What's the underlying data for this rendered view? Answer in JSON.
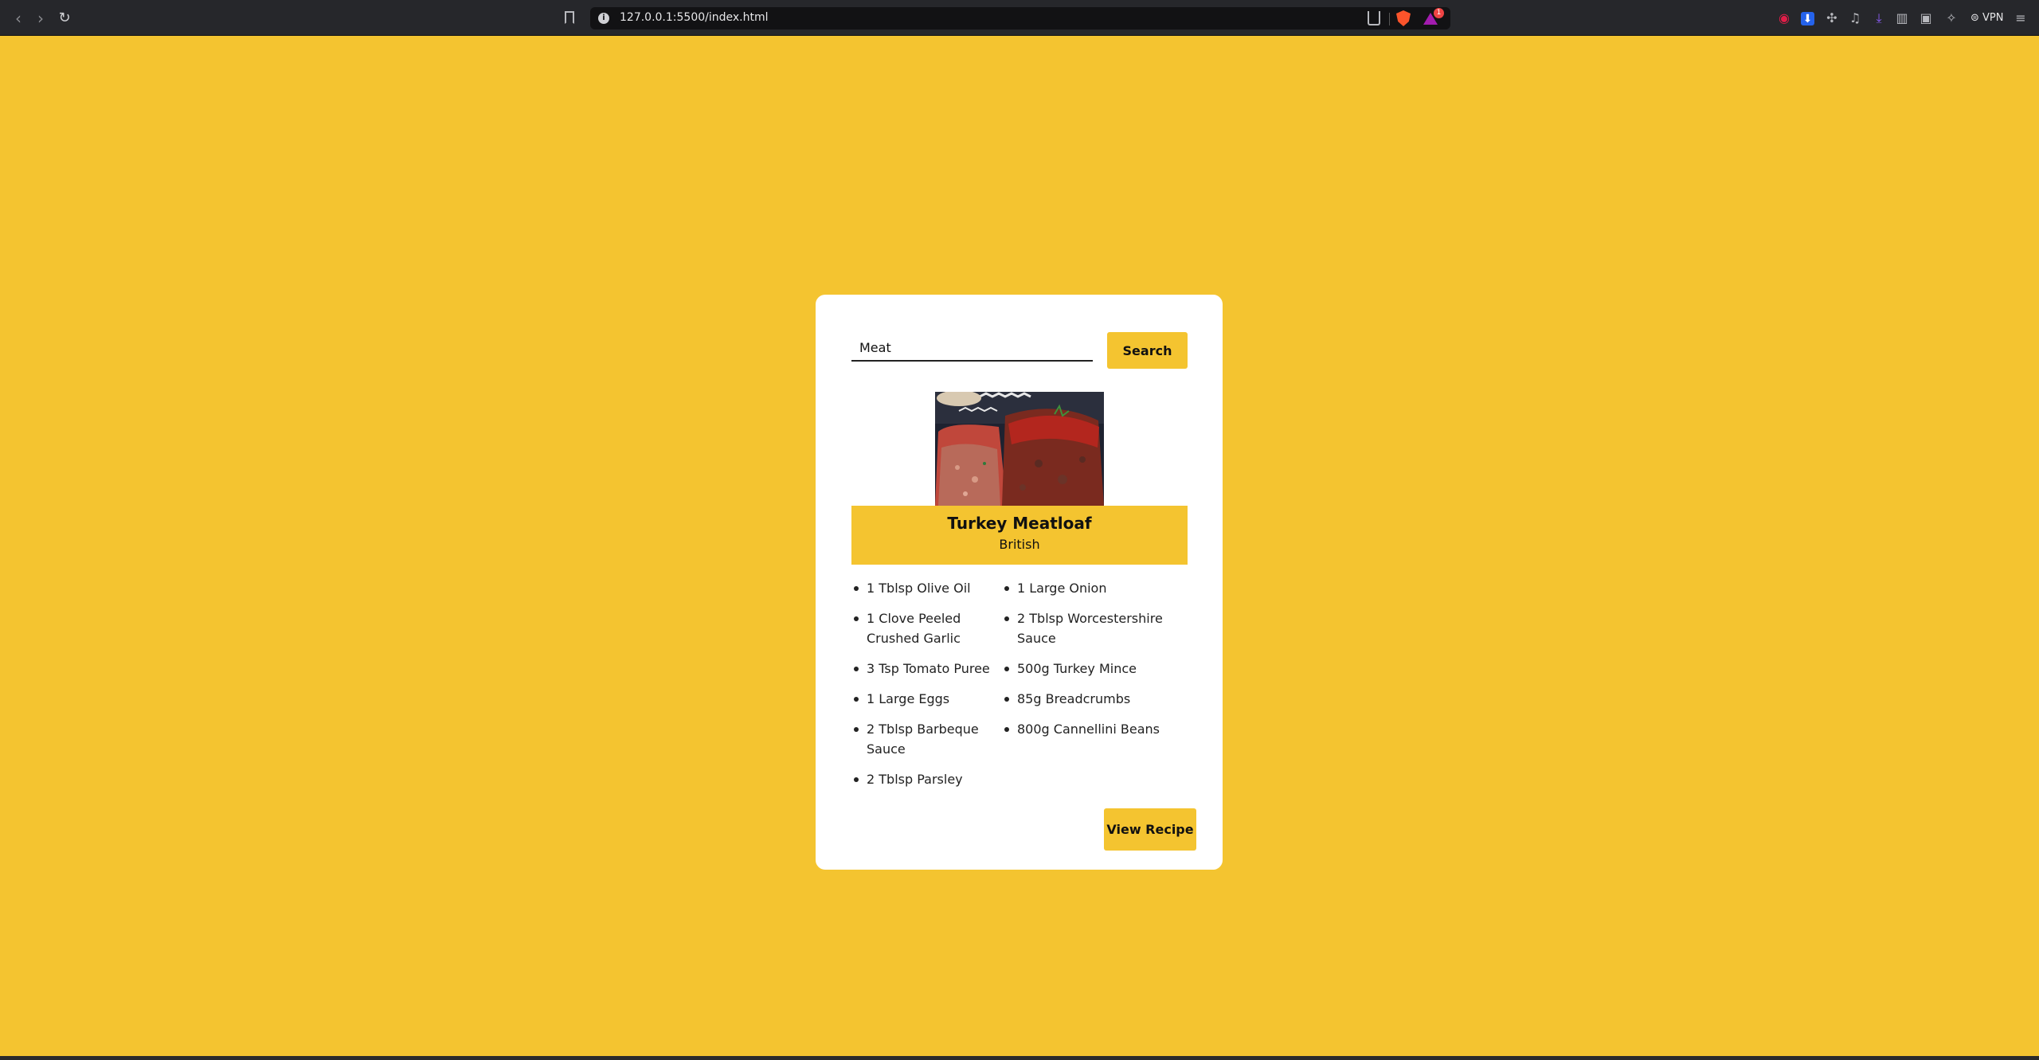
{
  "browser": {
    "url": "127.0.0.1:5500/index.html",
    "rewards_badge": "1",
    "vpn_label": "VPN"
  },
  "search": {
    "value": "Meat",
    "button_label": "Search"
  },
  "meal": {
    "title": "Turkey Meatloaf",
    "area": "British",
    "ingredients": [
      "1 Tblsp Olive Oil",
      "1 Clove Peeled Crushed Garlic",
      "3 Tsp Tomato Puree",
      "1 Large Eggs",
      "2 Tblsp Barbeque Sauce",
      "2 Tblsp Parsley",
      "1 Large Onion",
      "2 Tblsp Worcestershire Sauce",
      "500g Turkey Mince",
      "85g Breadcrumbs",
      "800g Cannellini Beans"
    ],
    "view_button_label": "View Recipe"
  },
  "colors": {
    "accent": "#f4c430",
    "card": "#ffffff",
    "chrome": "#26272b"
  }
}
